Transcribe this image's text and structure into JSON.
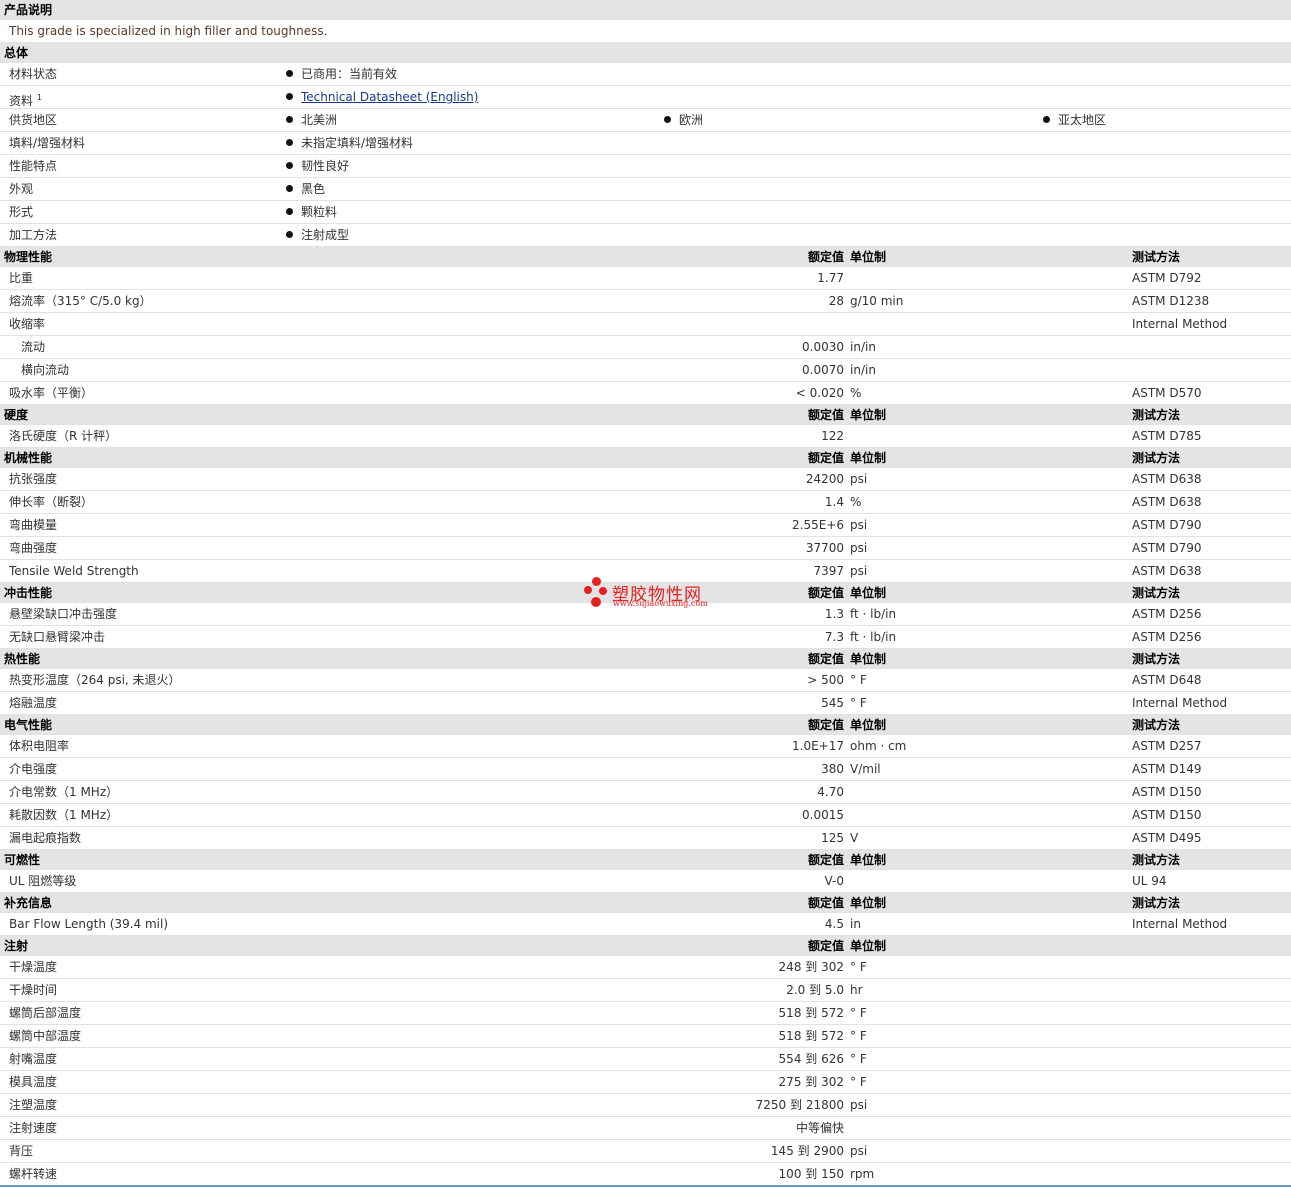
{
  "product": {
    "header": "产品说明",
    "description": "This grade is specialized in high filler and toughness."
  },
  "general": {
    "header": "总体",
    "rows": [
      {
        "name": "材料状态",
        "items": [
          "已商用：当前有效"
        ]
      },
      {
        "name": "资料",
        "sup": "1",
        "items": [
          "Technical Datasheet (English)"
        ],
        "link": true
      },
      {
        "name": "供货地区",
        "items": [
          "北美洲",
          "欧洲",
          "亚太地区"
        ]
      },
      {
        "name": "填料/增强材料",
        "items": [
          "未指定填料/增强材料"
        ]
      },
      {
        "name": "性能特点",
        "items": [
          "韧性良好"
        ]
      },
      {
        "name": "外观",
        "items": [
          "黑色"
        ]
      },
      {
        "name": "形式",
        "items": [
          "颗粒料"
        ]
      },
      {
        "name": "加工方法",
        "items": [
          "注射成型"
        ]
      }
    ]
  },
  "columns": {
    "value": "额定值",
    "unit": "单位制",
    "method": "测试方法"
  },
  "sections": [
    {
      "title": "物理性能",
      "show_method": true,
      "rows": [
        {
          "name": "比重",
          "value": "1.77",
          "unit": "",
          "method": "ASTM D792"
        },
        {
          "name": "熔流率（315° C/5.0 kg）",
          "value": "28",
          "unit": "g/10 min",
          "method": "ASTM D1238"
        },
        {
          "name": "收缩率",
          "value": "",
          "unit": "",
          "method": "Internal Method"
        },
        {
          "name": "流动",
          "indent": true,
          "value": "0.0030",
          "unit": "in/in",
          "method": ""
        },
        {
          "name": "横向流动",
          "indent": true,
          "value": "0.0070",
          "unit": "in/in",
          "method": ""
        },
        {
          "name": "吸水率（平衡）",
          "value": "< 0.020",
          "unit": "%",
          "method": "ASTM D570"
        }
      ]
    },
    {
      "title": "硬度",
      "show_method": true,
      "rows": [
        {
          "name": "洛氏硬度（R 计秤）",
          "value": "122",
          "unit": "",
          "method": "ASTM D785"
        }
      ]
    },
    {
      "title": "机械性能",
      "show_method": true,
      "rows": [
        {
          "name": "抗张强度",
          "value": "24200",
          "unit": "psi",
          "method": "ASTM D638"
        },
        {
          "name": "伸长率（断裂）",
          "value": "1.4",
          "unit": "%",
          "method": "ASTM D638"
        },
        {
          "name": "弯曲模量",
          "value": "2.55E+6",
          "unit": "psi",
          "method": "ASTM D790"
        },
        {
          "name": "弯曲强度",
          "value": "37700",
          "unit": "psi",
          "method": "ASTM D790"
        },
        {
          "name": "Tensile Weld Strength",
          "value": "7397",
          "unit": "psi",
          "method": "ASTM D638"
        }
      ]
    },
    {
      "title": "冲击性能",
      "show_method": true,
      "rows": [
        {
          "name": "悬壁梁缺口冲击强度",
          "value": "1.3",
          "unit": "ft · lb/in",
          "method": "ASTM D256"
        },
        {
          "name": "无缺口悬臂梁冲击",
          "value": "7.3",
          "unit": "ft · lb/in",
          "method": "ASTM D256"
        }
      ]
    },
    {
      "title": "热性能",
      "show_method": true,
      "rows": [
        {
          "name": "热变形温度（264 psi, 未退火）",
          "value": "> 500",
          "unit": "° F",
          "method": "ASTM D648"
        },
        {
          "name": "熔融温度",
          "value": "545",
          "unit": "° F",
          "method": "Internal Method"
        }
      ]
    },
    {
      "title": "电气性能",
      "show_method": true,
      "rows": [
        {
          "name": "体积电阻率",
          "value": "1.0E+17",
          "unit": "ohm · cm",
          "method": "ASTM D257"
        },
        {
          "name": "介电强度",
          "value": "380",
          "unit": "V/mil",
          "method": "ASTM D149"
        },
        {
          "name": "介电常数（1 MHz）",
          "value": "4.70",
          "unit": "",
          "method": "ASTM D150"
        },
        {
          "name": "耗散因数（1 MHz）",
          "value": "0.0015",
          "unit": "",
          "method": "ASTM D150"
        },
        {
          "name": "漏电起痕指数",
          "value": "125",
          "unit": "V",
          "method": "ASTM D495"
        }
      ]
    },
    {
      "title": "可燃性",
      "show_method": true,
      "rows": [
        {
          "name": "UL 阻燃等级",
          "value": "V-0",
          "unit": "",
          "method": "UL 94"
        }
      ]
    },
    {
      "title": "补充信息",
      "show_method": true,
      "rows": [
        {
          "name": "Bar Flow Length (39.4 mil)",
          "value": "4.5",
          "unit": "in",
          "method": "Internal Method"
        }
      ]
    },
    {
      "title": "注射",
      "show_method": false,
      "rows": [
        {
          "name": "干燥温度",
          "value": "248 到  302",
          "unit": "° F",
          "method": ""
        },
        {
          "name": "干燥时间",
          "value": "2.0 到  5.0",
          "unit": "hr",
          "method": ""
        },
        {
          "name": "螺筒后部温度",
          "value": "518 到  572",
          "unit": "° F",
          "method": ""
        },
        {
          "name": "螺筒中部温度",
          "value": "518 到  572",
          "unit": "° F",
          "method": ""
        },
        {
          "name": "射嘴温度",
          "value": "554 到  626",
          "unit": "° F",
          "method": ""
        },
        {
          "name": "模具温度",
          "value": "275 到  302",
          "unit": "° F",
          "method": ""
        },
        {
          "name": "注塑温度",
          "value": "7250 到  21800",
          "unit": "psi",
          "method": ""
        },
        {
          "name": "注射速度",
          "value": "中等偏快",
          "unit": "",
          "method": ""
        },
        {
          "name": "背压",
          "value": "145 到  2900",
          "unit": "psi",
          "method": ""
        },
        {
          "name": "螺杆转速",
          "value": "100 到  150",
          "unit": "rpm",
          "method": ""
        }
      ]
    }
  ],
  "watermark": {
    "name": "塑胶物性网",
    "url": "www.sujiaowuxing.com",
    "color": "#e62020"
  }
}
